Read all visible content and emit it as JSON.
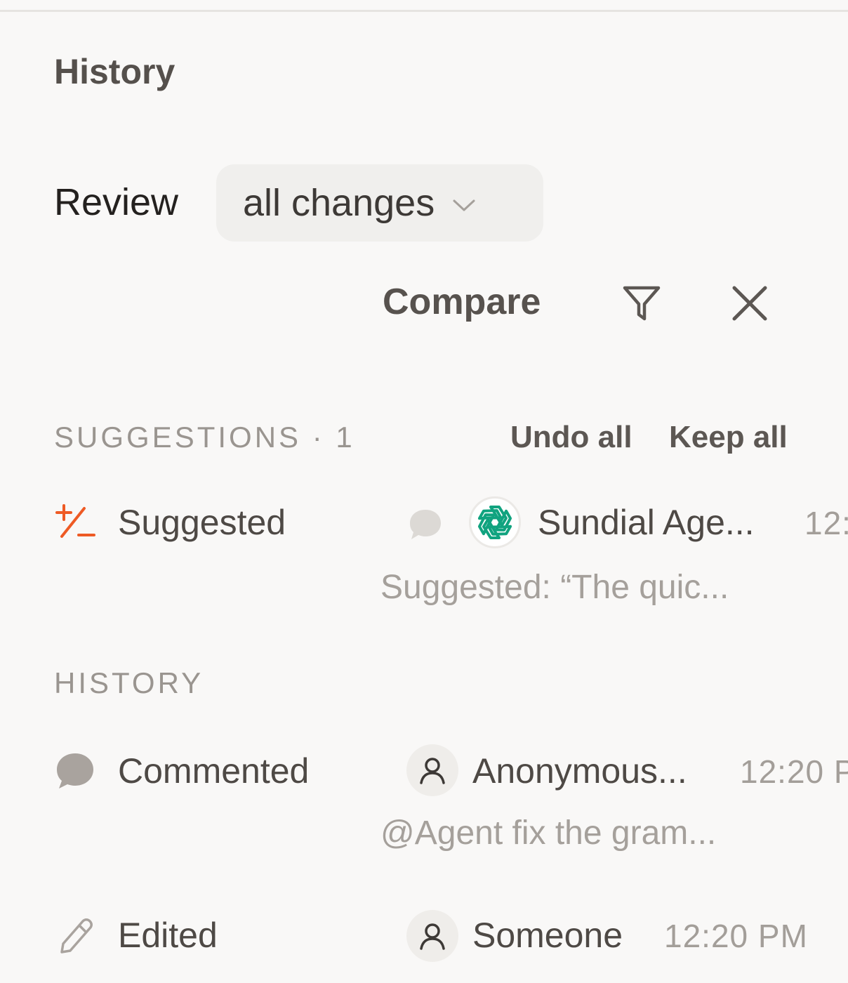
{
  "panel": {
    "title": "History"
  },
  "review": {
    "label": "Review",
    "selected": "all changes"
  },
  "toolbar": {
    "compare_label": "Compare"
  },
  "suggestions": {
    "header": "SUGGESTIONS · 1",
    "undo_all_label": "Undo all",
    "keep_all_label": "Keep all",
    "items": [
      {
        "type": "Suggested",
        "author": "Sundial Age...",
        "time": "12:",
        "summary": "Suggested: “The quic..."
      }
    ]
  },
  "history": {
    "header": "HISTORY",
    "items": [
      {
        "type": "Commented",
        "author": "Anonymous...",
        "time": "12:20 P",
        "summary": "@Agent fix the gram..."
      },
      {
        "type": "Edited",
        "author": "Someone",
        "time": "12:20 PM"
      }
    ]
  },
  "colors": {
    "suggestion_accent": "#ee5a24",
    "ai_brand": "#10a37f",
    "muted_icon": "#a9a39e"
  },
  "icons": {
    "suggestion": "plus-minus-icon",
    "comment": "speech-bubble-icon",
    "edit": "pencil-icon",
    "filter": "filter-icon",
    "close": "close-icon",
    "dropdown": "chevron-down-icon",
    "ai_avatar": "openai-logo-icon",
    "user_avatar": "user-icon"
  }
}
